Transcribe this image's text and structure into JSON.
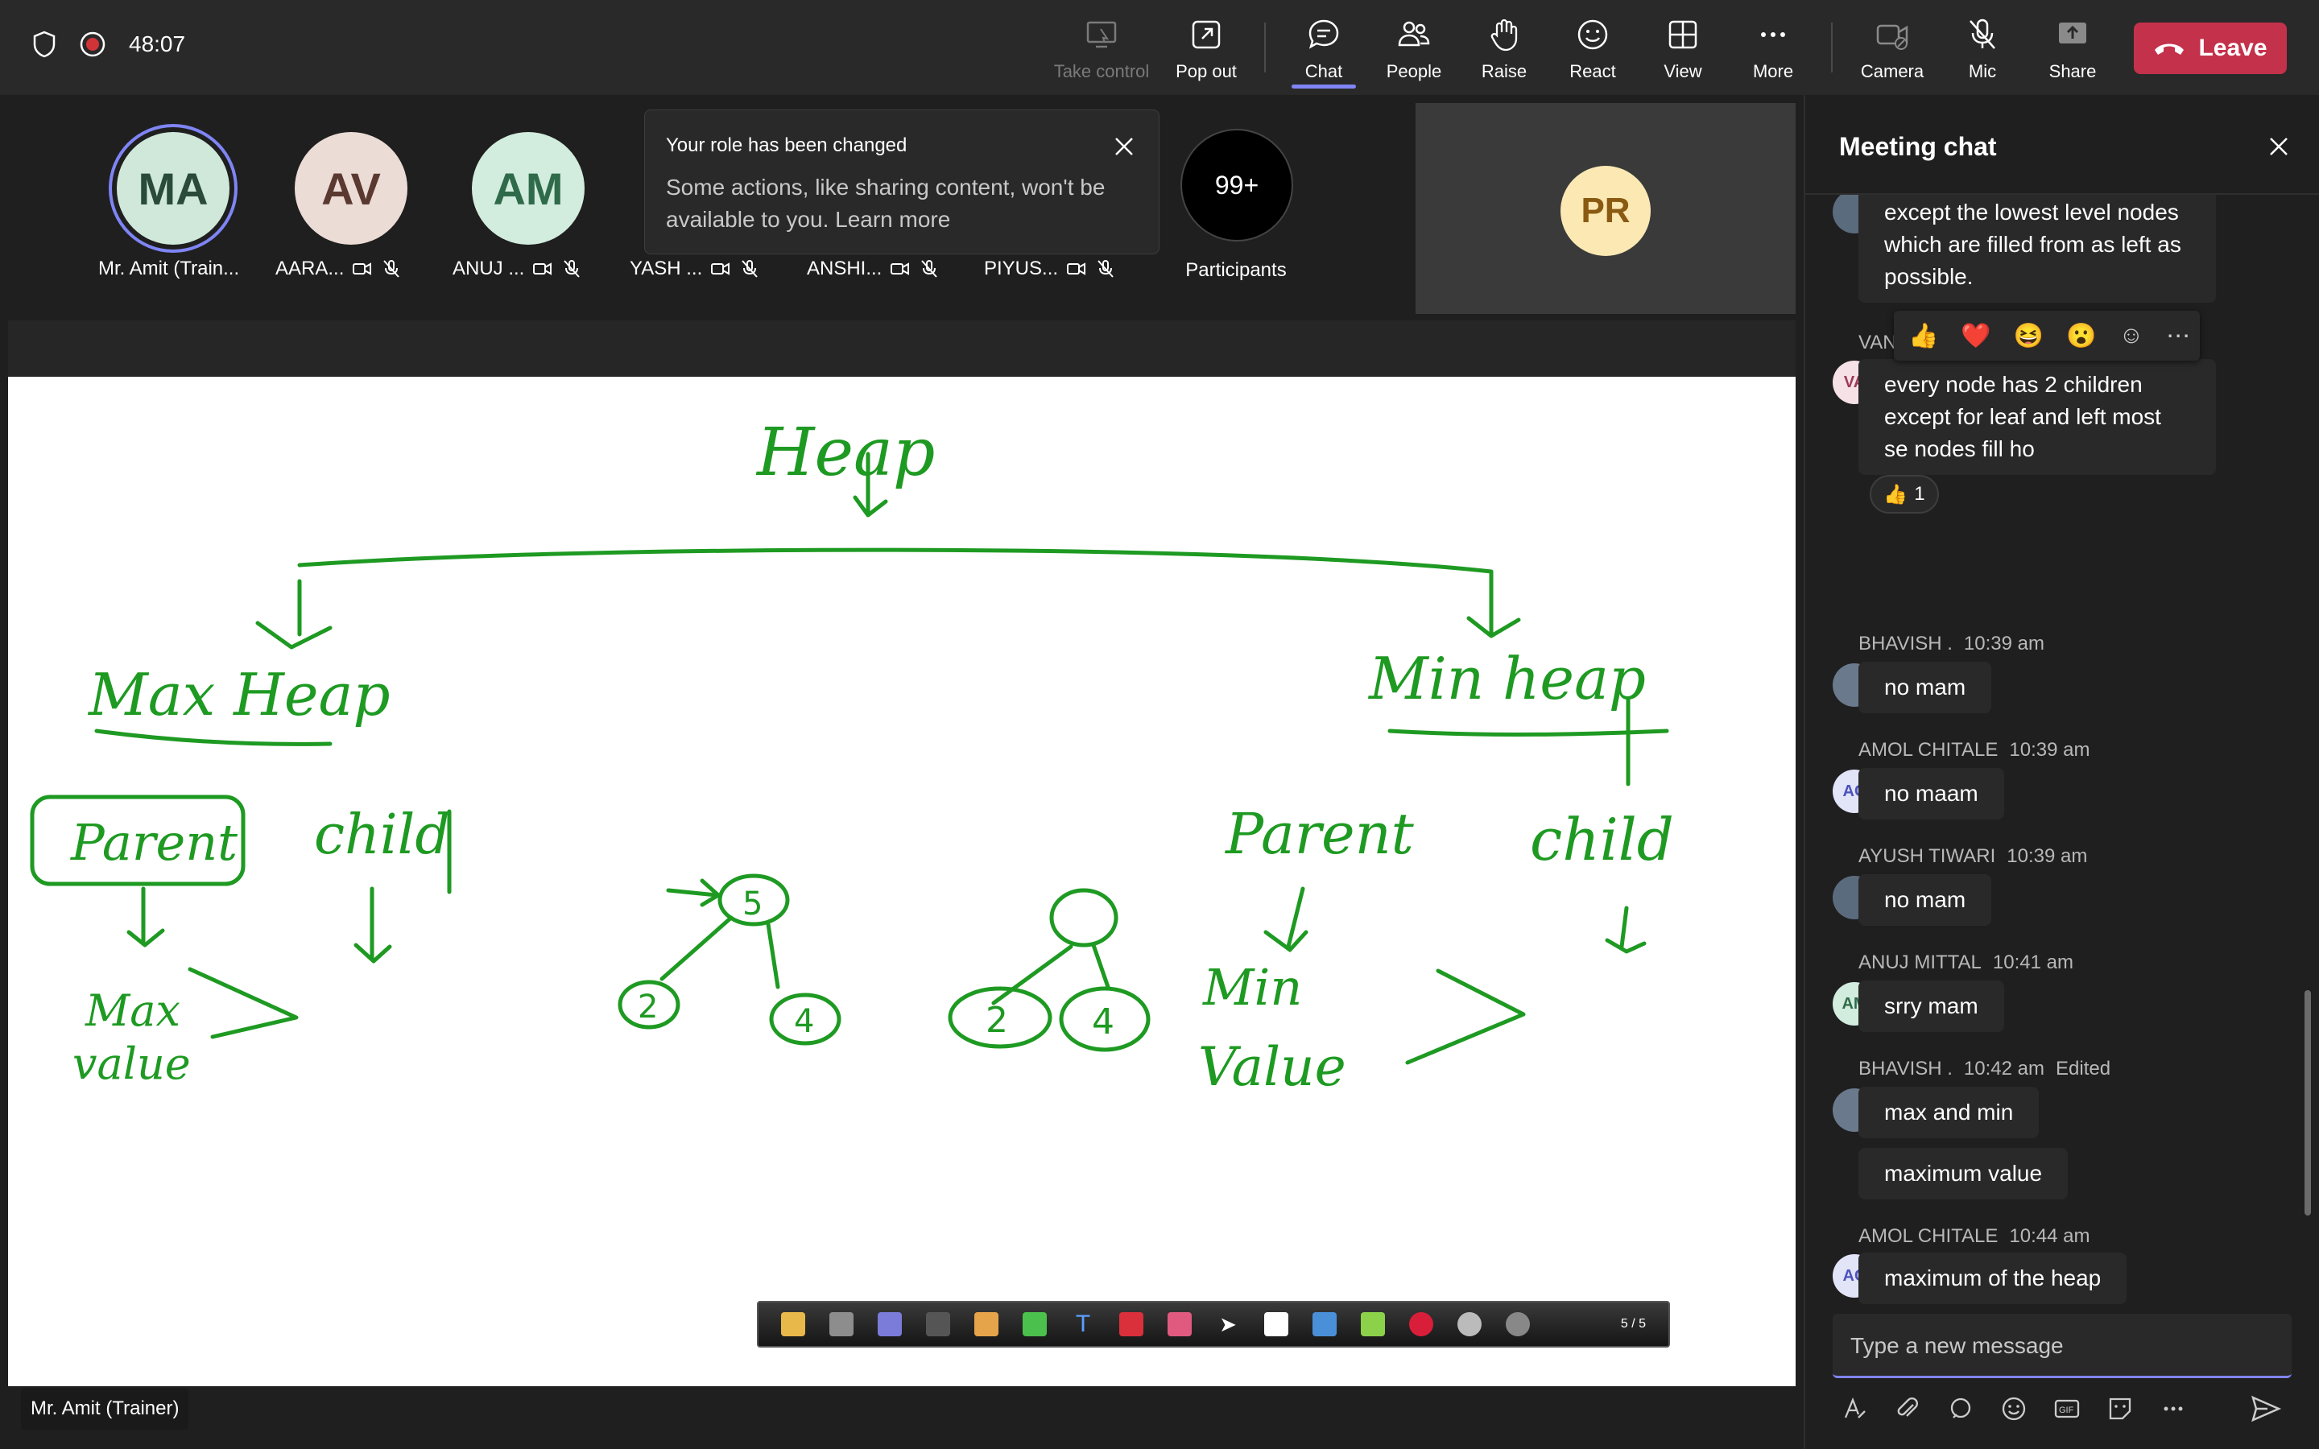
{
  "topbar": {
    "timer": "48:07",
    "buttons": {
      "take_control": "Take control",
      "pop_out": "Pop out",
      "chat": "Chat",
      "people": "People",
      "raise": "Raise",
      "react": "React",
      "view": "View",
      "more": "More",
      "camera": "Camera",
      "mic": "Mic",
      "share": "Share"
    },
    "leave": "Leave"
  },
  "participants": {
    "tiles": [
      {
        "initials": "MA",
        "name": "Mr. Amit (Train...",
        "bg": "#cfe8da",
        "fg": "#2a4b3a"
      },
      {
        "initials": "AV",
        "name": "AARA...",
        "bg": "#ecdcd6",
        "fg": "#5a3a30"
      },
      {
        "initials": "AM",
        "name": "ANUJ ...",
        "bg": "#d2ecde",
        "fg": "#2f6b4a"
      }
    ],
    "extra_names": [
      "YASH ...",
      "ANSHI...",
      "PIYUS..."
    ],
    "count": "99+",
    "count_label": "Participants",
    "video_tile_initials": "PR"
  },
  "toast": {
    "title": "Your role has been changed",
    "body": "Some actions, like sharing content, won't be available to you. Learn more"
  },
  "whiteboard": {
    "words": {
      "heap": "Heap",
      "max_heap": "Max Heap",
      "min_heap": "Min heap",
      "parent_left": "Parent",
      "child_left": "child",
      "max": "Max",
      "value_left": "value",
      "parent_right": "Parent",
      "child_right": "child",
      "min": "Min",
      "value_right": "Value",
      "node_5": "5",
      "node_2": "2",
      "node_4": "4",
      "node_2b": "2",
      "node_4b": "4"
    },
    "page_indicator": "5 / 5",
    "presenter_tag": "Mr. Amit (Trainer)"
  },
  "chat": {
    "title": "Meeting chat",
    "messages": [
      {
        "sender": "",
        "time": "",
        "text": "except the lowest level nodes which are filled from as left as possible."
      },
      {
        "sender": "VAN",
        "time": "",
        "text": "every node has 2 children except for leaf and left most se nodes fill ho",
        "reaction": "1"
      },
      {
        "sender": "BHAVISH .",
        "time": "10:39 am",
        "text": "no mam"
      },
      {
        "sender": "AMOL CHITALE",
        "time": "10:39 am",
        "text": "no maam"
      },
      {
        "sender": "AYUSH TIWARI",
        "time": "10:39 am",
        "text": "no mam"
      },
      {
        "sender": "ANUJ MITTAL",
        "time": "10:41 am",
        "text": "srry mam"
      },
      {
        "sender": "BHAVISH .",
        "time": "10:42 am",
        "edited": "Edited",
        "text": "max and min",
        "text2": "maximum value"
      },
      {
        "sender": "AMOL CHITALE",
        "time": "10:44 am",
        "text": "maximum of the heap"
      }
    ],
    "avatars": {
      "va": "VA",
      "ac": "AC",
      "am": "AM"
    },
    "composer_placeholder": "Type a new message"
  },
  "colors": {
    "accent": "#7f85f5",
    "leave": "#c4314b",
    "ink": "#1e9a22"
  }
}
